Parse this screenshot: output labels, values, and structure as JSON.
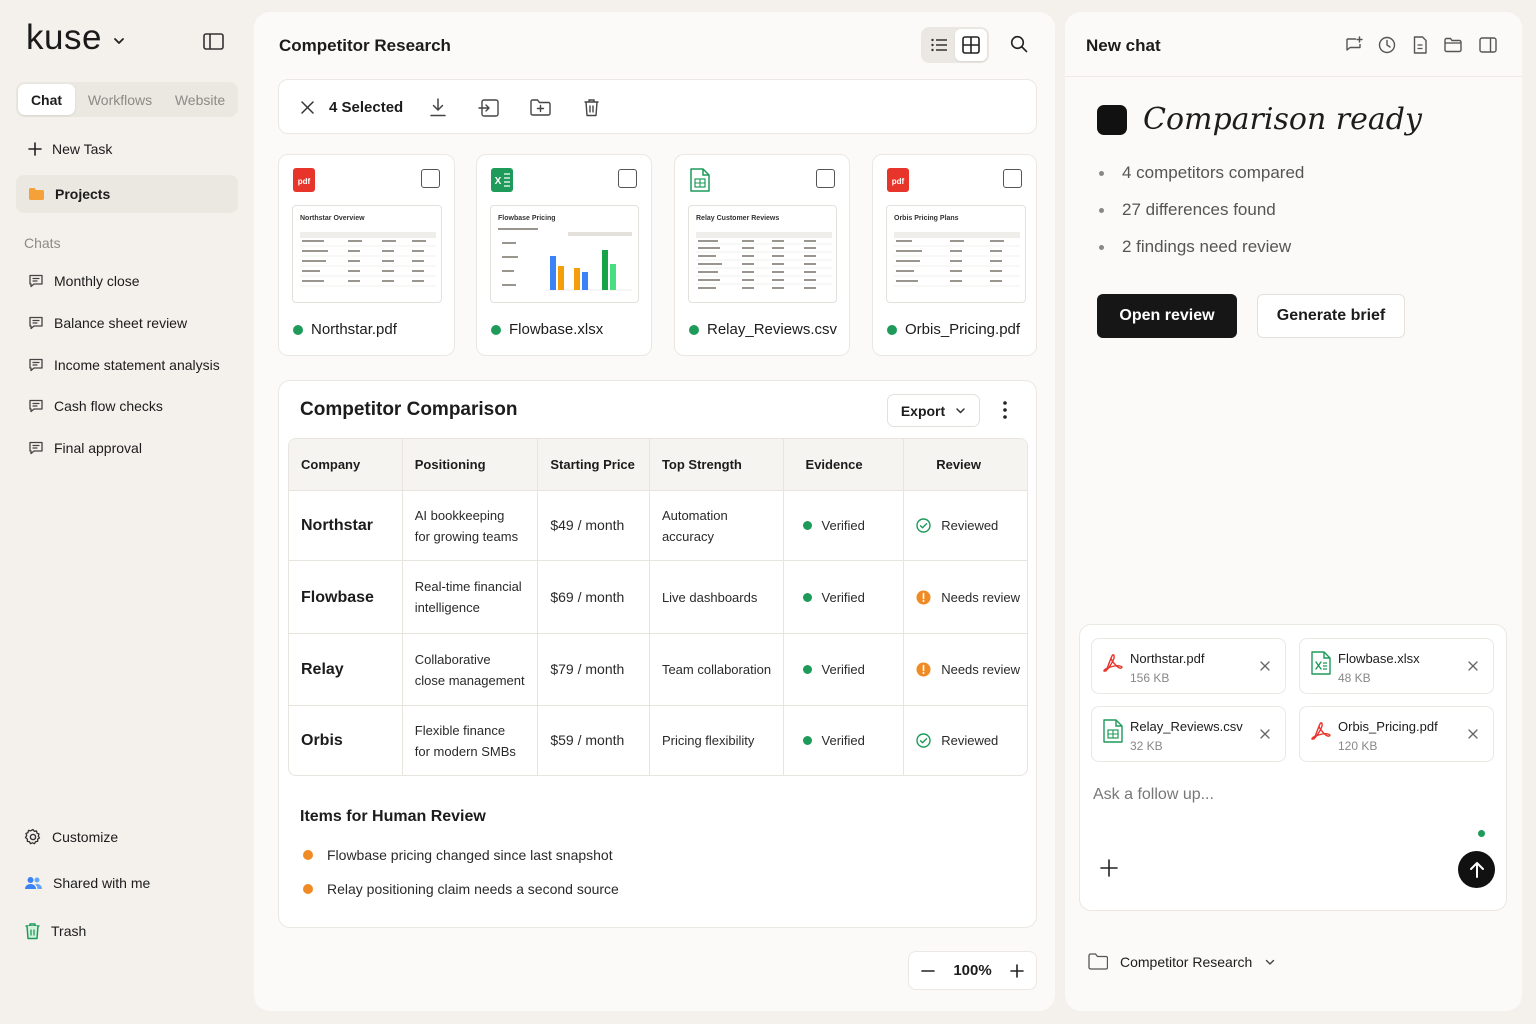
{
  "brand": {
    "name": "kuse"
  },
  "sidebar": {
    "tabs": [
      "Chat",
      "Workflows",
      "Website"
    ],
    "new_task": "New Task",
    "projects": "Projects",
    "chats_label": "Chats",
    "chats": [
      "Monthly close",
      "Balance sheet review",
      "Income statement analysis",
      "Cash flow checks",
      "Final approval"
    ],
    "bottom": {
      "customize": "Customize",
      "shared": "Shared with me",
      "trash": "Trash"
    }
  },
  "main": {
    "title": "Competitor Research",
    "selection": {
      "count_label": "4 Selected"
    },
    "files": [
      {
        "name": "Northstar.pdf",
        "type": "pdf",
        "thumb_title": "Northstar Overview"
      },
      {
        "name": "Flowbase.xlsx",
        "type": "xlsx",
        "thumb_title": "Flowbase Pricing"
      },
      {
        "name": "Relay_Reviews.csv",
        "type": "csv",
        "thumb_title": "Relay Customer Reviews"
      },
      {
        "name": "Orbis_Pricing.pdf",
        "type": "pdf",
        "thumb_title": "Orbis Pricing Plans"
      }
    ],
    "comparison": {
      "title": "Competitor Comparison",
      "export_label": "Export",
      "columns": [
        "Company",
        "Positioning",
        "Starting Price",
        "Top Strength",
        "Evidence",
        "Review"
      ],
      "rows": [
        {
          "company": "Northstar",
          "positioning": [
            "AI bookkeeping",
            "for growing teams"
          ],
          "price": "$49 / month",
          "strength": [
            "Automation",
            "accuracy"
          ],
          "evidence": "Verified",
          "review": "Reviewed",
          "review_state": "ok"
        },
        {
          "company": "Flowbase",
          "positioning": [
            "Real-time financial",
            "intelligence"
          ],
          "price": "$69 / month",
          "strength": [
            "Live dashboards"
          ],
          "evidence": "Verified",
          "review": "Needs review",
          "review_state": "warn"
        },
        {
          "company": "Relay",
          "positioning": [
            "Collaborative",
            "close management"
          ],
          "price": "$79 / month",
          "strength": [
            "Team collaboration"
          ],
          "evidence": "Verified",
          "review": "Needs review",
          "review_state": "warn"
        },
        {
          "company": "Orbis",
          "positioning": [
            "Flexible finance",
            "for modern SMBs"
          ],
          "price": "$59 / month",
          "strength": [
            "Pricing flexibility"
          ],
          "evidence": "Verified",
          "review": "Reviewed",
          "review_state": "ok"
        }
      ],
      "review_heading": "Items for Human Review",
      "review_items": [
        "Flowbase pricing changed since last snapshot",
        "Relay positioning claim needs a second source"
      ]
    },
    "zoom": "100%"
  },
  "chat": {
    "title": "New chat",
    "ready_title": "Comparison ready",
    "bullets": [
      "4 competitors compared",
      "27 differences found",
      "2 findings need review"
    ],
    "primary_button": "Open review",
    "secondary_button": "Generate brief",
    "attachments": [
      {
        "name": "Northstar.pdf",
        "size": "156 KB",
        "type": "pdf"
      },
      {
        "name": "Flowbase.xlsx",
        "size": "48 KB",
        "type": "xlsx"
      },
      {
        "name": "Relay_Reviews.csv",
        "size": "32 KB",
        "type": "csv"
      },
      {
        "name": "Orbis_Pricing.pdf",
        "size": "120 KB",
        "type": "pdf"
      }
    ],
    "input_placeholder": "Ask a follow up...",
    "folder": "Competitor Research"
  },
  "colors": {
    "accent_dark": "#161616",
    "verified_green": "#1e9a5a",
    "warn_orange": "#f08a24",
    "pdf_red": "#e8352b",
    "xlsx_green": "#1e9a5a",
    "folder_orange": "#f5a13a"
  }
}
